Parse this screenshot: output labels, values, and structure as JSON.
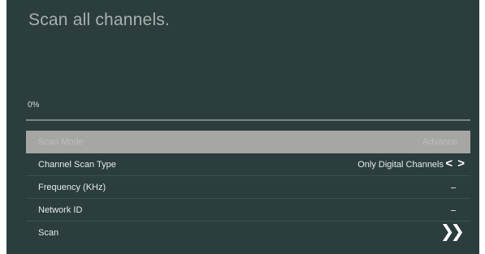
{
  "title": "Scan all channels.",
  "progress": {
    "label": "0%",
    "value": 0
  },
  "menu": {
    "items": [
      {
        "label": "Scan Mode",
        "value": "Advance",
        "state": "disabled"
      },
      {
        "label": "Channel Scan Type",
        "value": "Only Digital Channels",
        "control": "< >"
      },
      {
        "label": "Frequency (KHz)",
        "value": "_"
      },
      {
        "label": "Network ID",
        "value": "_"
      },
      {
        "label": "Scan",
        "control": ">>"
      }
    ]
  },
  "icons": {
    "left_right_arrows": "chevron-left-right-icon",
    "start_scan": "double-chevron-right-icon"
  },
  "colors": {
    "background": "#2b3d3d",
    "disabled_row": "#a6a6a4",
    "text": "#e6eaea",
    "title": "#a9b1b0"
  }
}
